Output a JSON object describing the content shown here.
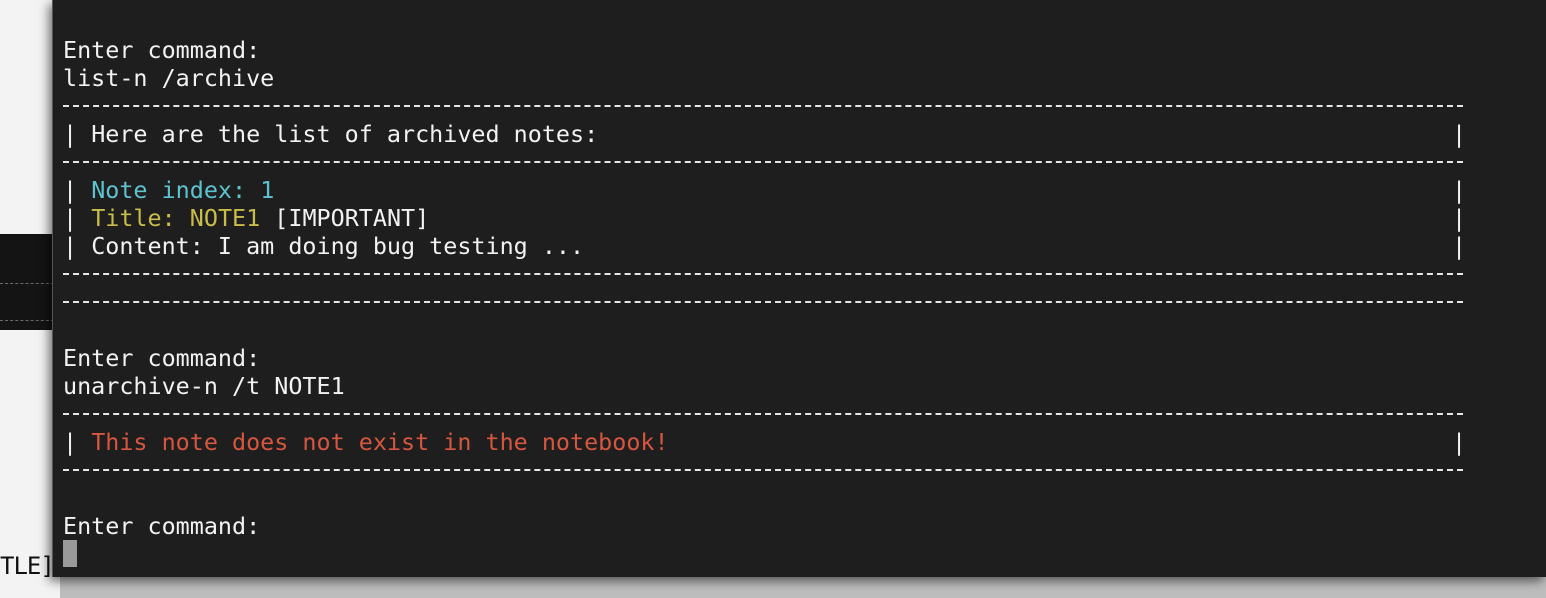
{
  "background_window": {
    "clipped_text": "TLE]"
  },
  "terminal": {
    "block1": {
      "prompt": "Enter command:",
      "command": "list-n /archive",
      "header": "Here are the list of archived notes:",
      "note": {
        "index_label": "Note index:",
        "index_value": "1",
        "title_label": "Title:",
        "title_value": "NOTE1",
        "title_tag": "[IMPORTANT]",
        "content": "Content: I am doing bug testing ..."
      }
    },
    "block2": {
      "prompt": "Enter command:",
      "command": "unarchive-n /t NOTE1",
      "error": "This note does not exist in the notebook!"
    },
    "block3": {
      "prompt": "Enter command:"
    },
    "border_char": "|",
    "colors": {
      "background": "#1e1e1e",
      "text": "#f2f2f2",
      "note_index": "#5fc3cf",
      "title": "#c9bd4a",
      "error": "#d7563f"
    }
  }
}
